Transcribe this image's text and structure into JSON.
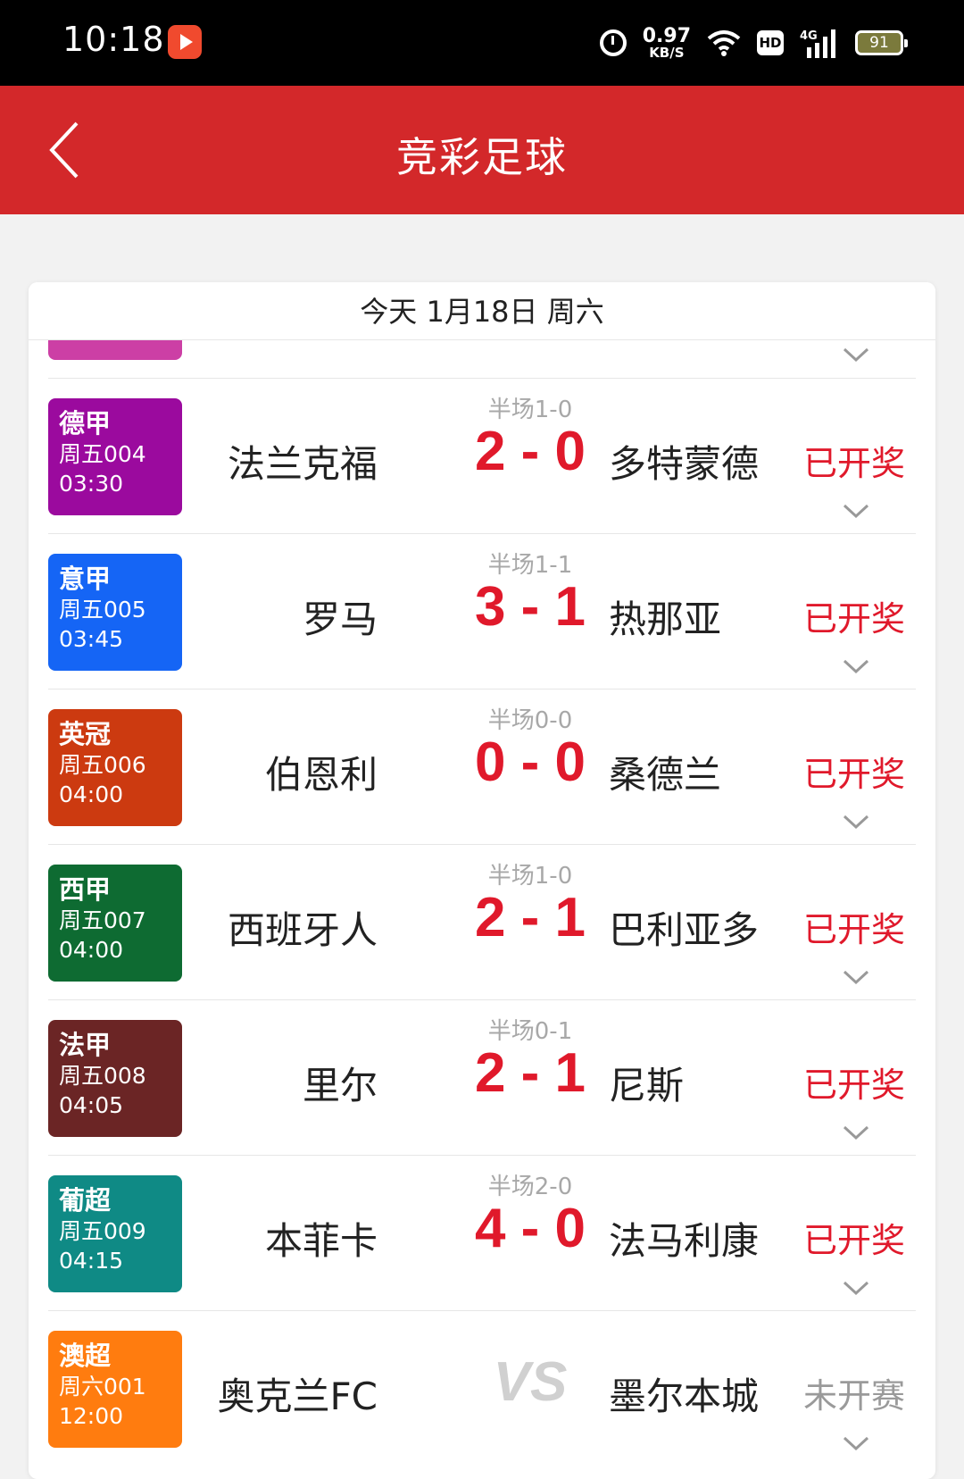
{
  "status_bar": {
    "time": "10:18",
    "net_speed_value": "0.97",
    "net_speed_unit": "KB/S",
    "hd_label": "HD",
    "network_label": "4G",
    "battery_level": "91"
  },
  "header": {
    "title": "竞彩足球",
    "background_color": "#d3282a"
  },
  "date_header": "今天 1月18日 周六",
  "matches": [
    {
      "league": "德甲",
      "code": "周五004",
      "time": "03:30",
      "badge_color": "#9b0a9e",
      "home": "法兰克福",
      "away": "多特蒙德",
      "halftime": "半场1-0",
      "score": "2 - 0",
      "status": "已开奖"
    },
    {
      "league": "意甲",
      "code": "周五005",
      "time": "03:45",
      "badge_color": "#1565f5",
      "home": "罗马",
      "away": "热那亚",
      "halftime": "半场1-1",
      "score": "3 - 1",
      "status": "已开奖"
    },
    {
      "league": "英冠",
      "code": "周五006",
      "time": "04:00",
      "badge_color": "#cc3a10",
      "home": "伯恩利",
      "away": "桑德兰",
      "halftime": "半场0-0",
      "score": "0 - 0",
      "status": "已开奖"
    },
    {
      "league": "西甲",
      "code": "周五007",
      "time": "04:00",
      "badge_color": "#0e6b32",
      "home": "西班牙人",
      "away": "巴利亚多",
      "halftime": "半场1-0",
      "score": "2 - 1",
      "status": "已开奖"
    },
    {
      "league": "法甲",
      "code": "周五008",
      "time": "04:05",
      "badge_color": "#6b2525",
      "home": "里尔",
      "away": "尼斯",
      "halftime": "半场0-1",
      "score": "2 - 1",
      "status": "已开奖"
    },
    {
      "league": "葡超",
      "code": "周五009",
      "time": "04:15",
      "badge_color": "#0f8a85",
      "home": "本菲卡",
      "away": "法马利康",
      "halftime": "半场2-0",
      "score": "4 - 0",
      "status": "已开奖"
    },
    {
      "league": "澳超",
      "code": "周六001",
      "time": "12:00",
      "badge_color": "#ff7c0f",
      "home": "奥克兰FC",
      "away": "墨尔本城",
      "vs": "VS",
      "status": "未开赛"
    }
  ]
}
